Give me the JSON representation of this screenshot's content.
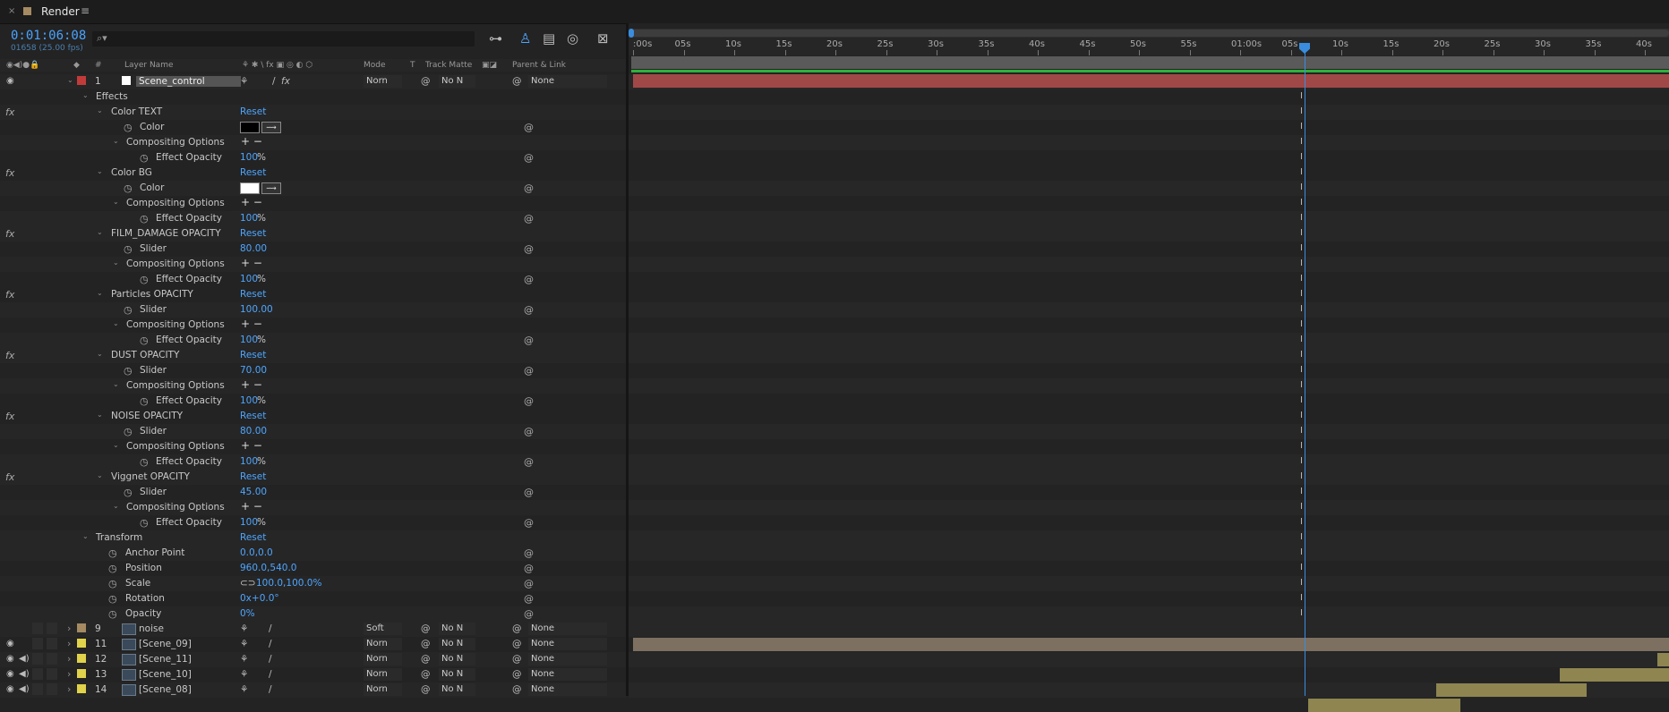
{
  "panel": {
    "title": "Render",
    "close_glyph": "×",
    "menu_glyph": "≡"
  },
  "time": {
    "timecode": "0:01:06:08",
    "frames": "01658 (25.00 fps)"
  },
  "search": {
    "icon_glyph": "⌕▾",
    "placeholder": ""
  },
  "toolbar": {
    "t1": "⊶",
    "t2": "♙",
    "t3": "▤",
    "t4": "◎",
    "t5": "⊠"
  },
  "headers": {
    "hash": "#",
    "layer_name": "Layer Name",
    "switches": "⚘ ✱ \\ fx ▣ ◎ ◐ ⬡",
    "mode": "Mode",
    "t": "T",
    "track_matte": "Track Matte",
    "parent_link": "Parent & Link"
  },
  "ruler": {
    "ticks": [
      ":00s",
      "05s",
      "10s",
      "15s",
      "20s",
      "25s",
      "30s",
      "35s",
      "40s",
      "45s",
      "50s",
      "55s",
      "01:00s",
      "05s",
      "10s",
      "15s",
      "20s",
      "25s",
      "30s",
      "35s",
      "40s"
    ]
  },
  "layer1": {
    "num": "1",
    "name": "Scene_control",
    "mode": "Norn",
    "matte": "No N",
    "parent": "None",
    "label_color": "#c23b3b"
  },
  "effects_group": "Effects",
  "effects": [
    {
      "name": "Color TEXT",
      "reset": "Reset",
      "param": "Color",
      "param_type": "color",
      "swatch": "#000000",
      "comp": "Compositing Options",
      "opacity_label": "Effect Opacity",
      "opacity": "100",
      "pct": "%"
    },
    {
      "name": "Color BG",
      "reset": "Reset",
      "param": "Color",
      "param_type": "color",
      "swatch": "#ffffff",
      "comp": "Compositing Options",
      "opacity_label": "Effect Opacity",
      "opacity": "100",
      "pct": "%"
    },
    {
      "name": "FILM_DAMAGE OPACITY",
      "reset": "Reset",
      "param": "Slider",
      "param_type": "value",
      "value": "80.00",
      "comp": "Compositing Options",
      "opacity_label": "Effect Opacity",
      "opacity": "100",
      "pct": "%"
    },
    {
      "name": "Particles OPACITY",
      "reset": "Reset",
      "param": "Slider",
      "param_type": "value",
      "value": "100.00",
      "comp": "Compositing Options",
      "opacity_label": "Effect Opacity",
      "opacity": "100",
      "pct": "%"
    },
    {
      "name": "DUST OPACITY",
      "reset": "Reset",
      "param": "Slider",
      "param_type": "value",
      "value": "70.00",
      "comp": "Compositing Options",
      "opacity_label": "Effect Opacity",
      "opacity": "100",
      "pct": "%"
    },
    {
      "name": "NOISE OPACITY",
      "reset": "Reset",
      "param": "Slider",
      "param_type": "value",
      "value": "80.00",
      "comp": "Compositing Options",
      "opacity_label": "Effect Opacity",
      "opacity": "100",
      "pct": "%"
    },
    {
      "name": "Viggnet OPACITY",
      "reset": "Reset",
      "param": "Slider",
      "param_type": "value",
      "value": "45.00",
      "comp": "Compositing Options",
      "opacity_label": "Effect Opacity",
      "opacity": "100",
      "pct": "%"
    }
  ],
  "transform": {
    "name": "Transform",
    "reset": "Reset",
    "props": [
      {
        "label": "Anchor Point",
        "value": "0.0,0.0"
      },
      {
        "label": "Position",
        "value": "960.0,540.0"
      },
      {
        "label": "Scale",
        "value": "100.0,100.0%",
        "link": "⊂⊃"
      },
      {
        "label": "Rotation",
        "value": "0x+0.0°"
      },
      {
        "label": "Opacity",
        "value": "0%"
      }
    ]
  },
  "layers": [
    {
      "num": "9",
      "name": "noise",
      "mode": "Soft",
      "matte": "No N",
      "parent": "None",
      "label_color": "#a58a62",
      "eye": "",
      "spk": ""
    },
    {
      "num": "11",
      "name": "[Scene_09]",
      "mode": "Norn",
      "matte": "No N",
      "parent": "None",
      "label_color": "#e0d24a",
      "eye": "◉",
      "spk": ""
    },
    {
      "num": "12",
      "name": "[Scene_11]",
      "mode": "Norn",
      "matte": "No N",
      "parent": "None",
      "label_color": "#e0d24a",
      "eye": "◉",
      "spk": "◀)"
    },
    {
      "num": "13",
      "name": "[Scene_10]",
      "mode": "Norn",
      "matte": "No N",
      "parent": "None",
      "label_color": "#e0d24a",
      "eye": "◉",
      "spk": "◀)"
    },
    {
      "num": "14",
      "name": "[Scene_08]",
      "mode": "Norn",
      "matte": "No N",
      "parent": "None",
      "label_color": "#e0d24a",
      "eye": "◉",
      "spk": "◀)"
    }
  ],
  "glyphs": {
    "spiral": "@",
    "stopwatch": "◷",
    "fx": "fx",
    "plus_minus": "+ −",
    "down": "⌄",
    "right": "›",
    "eyedrop": "⟿",
    "shy": "⚘",
    "slash": "/",
    "ibeam": "I",
    "caret": "▾"
  },
  "colors": {
    "accent": "#4ea6ff",
    "playhead": "#3a8dde",
    "layer1_bar": "#a04848",
    "clip": "#8e8550",
    "noise_bar": "#7d7060"
  }
}
